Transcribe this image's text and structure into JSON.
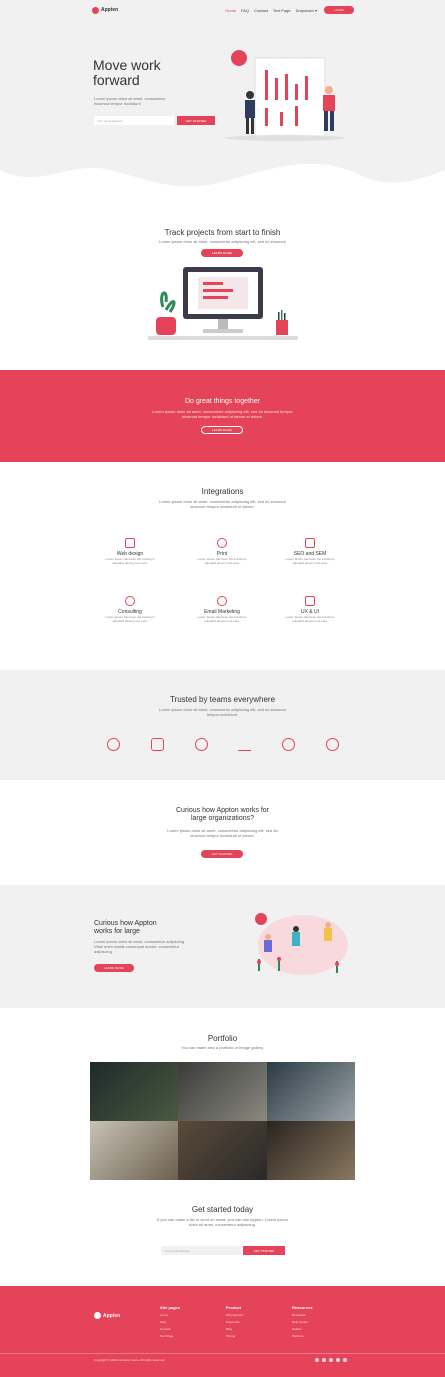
{
  "colors": {
    "accent": "#e5435a",
    "light_bg": "#f1f1f1"
  },
  "nav": {
    "brand": "Appten",
    "links": [
      "Home",
      "FAQ",
      "Contact",
      "Text Page",
      "Dropdown"
    ],
    "login": "LOGIN"
  },
  "hero": {
    "title_line1": "Move work",
    "title_line2": "forward",
    "desc_line1": "Lorem ipsum dolor sit amet, consectetur",
    "desc_line2": "eiusmod tempor incididunt",
    "email_placeholder": "Your email address",
    "cta": "GET STARTED"
  },
  "track": {
    "title": "Track projects from start to finish",
    "desc": "Lorem ipsum dolor sit amet, consectetur adipiscing elit, sed do eiusmod",
    "cta": "LEARN MORE"
  },
  "red_band": {
    "title": "Do great things together",
    "desc_line1": "Lorem ipsum dolor sit amet, consectetur adipiscing elit, sed do eiusmod tempor",
    "desc_line2": "eiusmod tempor incididunt ut labore et dolore.",
    "cta": "LEARN MORE"
  },
  "integrations": {
    "title": "Integrations",
    "desc_line1": "Lorem ipsum dolor sit amet, consectetur adipiscing elit, sed do eiusmod",
    "desc_line2": "eiusmod tempor incididunt ut labore.",
    "features": [
      {
        "icon": "monitor-icon",
        "title": "Web design",
        "desc1": "Lorem Ipsum has been the industry's",
        "desc2": "standard dummy text ever."
      },
      {
        "icon": "print-icon",
        "title": "Print",
        "desc1": "Lorem Ipsum has been the industry's",
        "desc2": "standard dummy text ever."
      },
      {
        "icon": "seo-icon",
        "title": "SEO and SEM",
        "desc1": "Lorem Ipsum has been the industry's",
        "desc2": "standard dummy text ever."
      },
      {
        "icon": "bulb-icon",
        "title": "Consulting",
        "desc1": "Lorem Ipsum has been the industry's",
        "desc2": "standard dummy text ever."
      },
      {
        "icon": "clock-icon",
        "title": "Email Marketing",
        "desc1": "Lorem Ipsum has been the industry's",
        "desc2": "standard dummy text ever."
      },
      {
        "icon": "pen-icon",
        "title": "UX & UI",
        "desc1": "Lorem Ipsum has been the industry's",
        "desc2": "standard dummy text ever."
      }
    ]
  },
  "trusted": {
    "title": "Trusted by teams everywhere",
    "desc_line1": "Lorem ipsum dolor sit amet, consectetur adipiscing elit, sed do eiusmod",
    "desc_line2": "tempor incididunt."
  },
  "curious1": {
    "title_line1": "Curious how Appton works for",
    "title_line2": "large organizations?",
    "desc_line1": "Lorem ipsum dolor sit amet, consectetur adipiscing elit, sed do",
    "desc_line2": "eiusmod tempor incididunt ut labore.",
    "cta": "GET STARTED"
  },
  "curious2": {
    "title_line1": "Curious how Appton",
    "title_line2": "works for large",
    "desc_line1": "Lorem ipsum dolor sit amet, consectetur adipiscing.",
    "desc_line2": "Vitae enim mattis consequat auctor, consectetur",
    "desc_line3": "adipiscing.",
    "cta": "LEARN MORE"
  },
  "portfolio": {
    "title": "Portfolio",
    "desc": "You can make also a portfolio or image gallery."
  },
  "get_started": {
    "title": "Get started today",
    "desc_line1": "If you can make a list or send an email, you can use Appton. Lorem ipsum",
    "desc_line2": "dolor sit amet, consectetur adipiscing.",
    "email_placeholder": "Your email address",
    "cta": "GET STARTED"
  },
  "footer": {
    "brand": "Appten",
    "columns": [
      {
        "head": "Site pages",
        "links": [
          "Home",
          "FAQ",
          "Contact",
          "Text Page"
        ]
      },
      {
        "head": "Product",
        "links": [
          "Why Appton?",
          "Enterprise",
          "Blog",
          "Pricing"
        ]
      },
      {
        "head": "Resources",
        "links": [
          "Download",
          "Help Center",
          "Guides",
          "Partners"
        ]
      }
    ],
    "copyright": "Copyright © 2020 company name. All rights reserved."
  }
}
